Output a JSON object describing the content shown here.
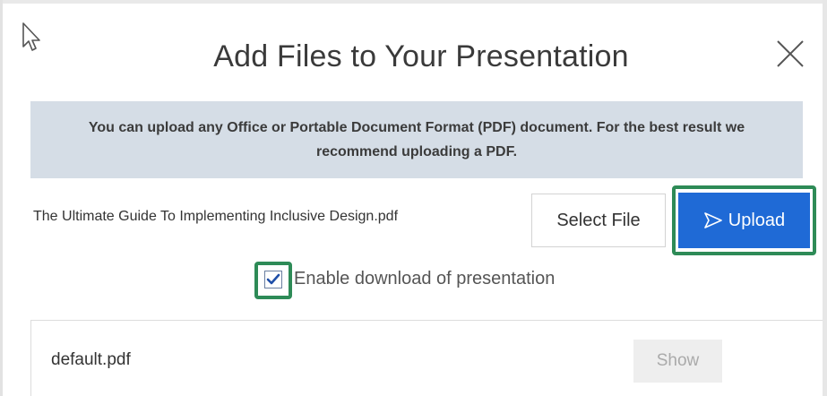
{
  "dialog": {
    "title": "Add Files to Your Presentation",
    "close_icon": "close-icon"
  },
  "info": {
    "message": "You can upload any Office or Portable Document Format (PDF) document.  For the best result we recommend uploading a PDF."
  },
  "upload": {
    "selected_filename": "The Ultimate Guide To Implementing Inclusive Design.pdf",
    "select_file_label": "Select File",
    "upload_label": "Upload",
    "upload_icon": "send-arrow-icon"
  },
  "options": {
    "enable_download_label": "Enable download of presentation",
    "enable_download_checked": true
  },
  "files": [
    {
      "name": "default.pdf",
      "action_label": "Show"
    }
  ],
  "colors": {
    "banner_background": "#d5dde6",
    "upload_button": "#1f6ad6",
    "highlight_border": "#2e8b57"
  }
}
